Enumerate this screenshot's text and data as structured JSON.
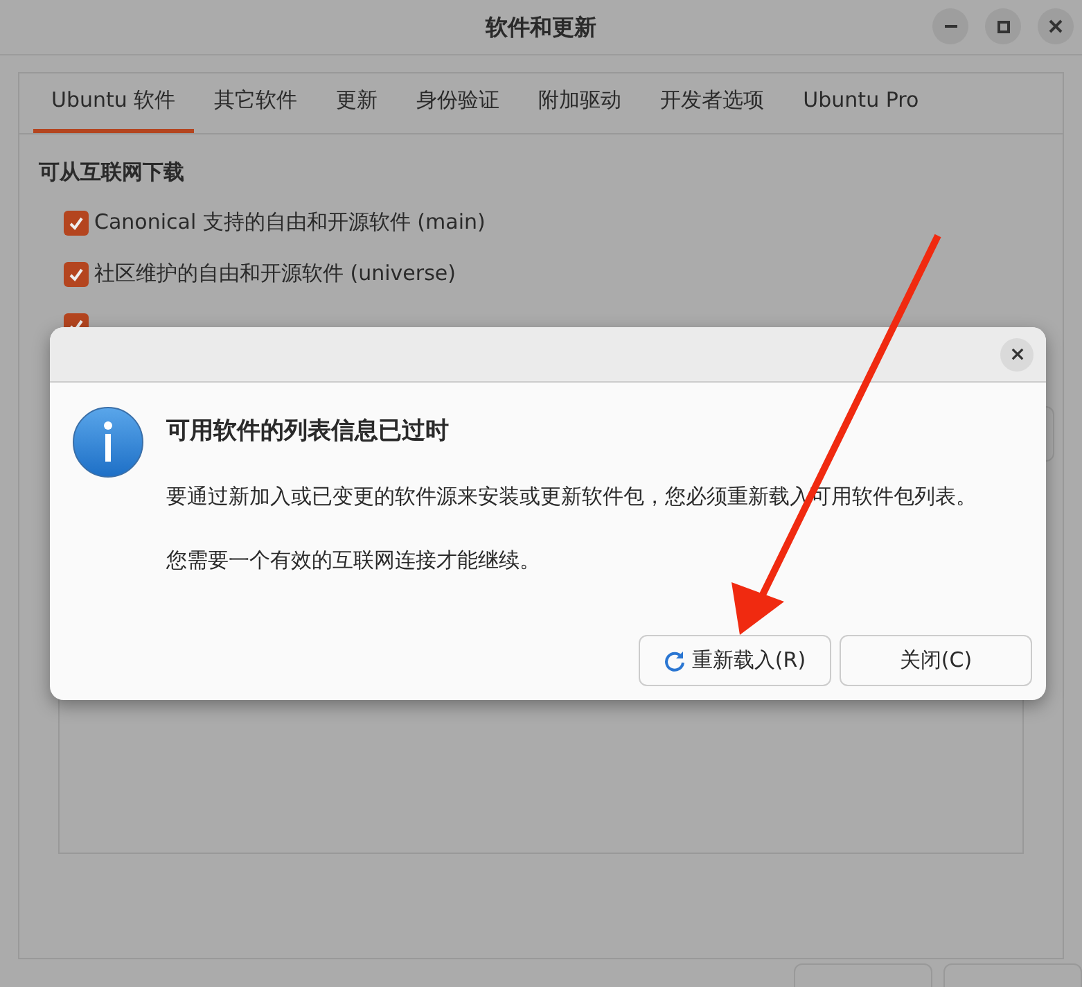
{
  "window": {
    "title": "软件和更新"
  },
  "tabs": [
    {
      "label": "Ubuntu 软件",
      "selected": true
    },
    {
      "label": "其它软件",
      "selected": false
    },
    {
      "label": "更新",
      "selected": false
    },
    {
      "label": "身份验证",
      "selected": false
    },
    {
      "label": "附加驱动",
      "selected": false
    },
    {
      "label": "开发者选项",
      "selected": false
    },
    {
      "label": "Ubuntu Pro",
      "selected": false
    }
  ],
  "section": {
    "heading": "可从互联网下载",
    "options": [
      {
        "label": "Canonical 支持的自由和开源软件 (main)",
        "checked": true
      },
      {
        "label": "社区维护的自由和开源软件 (universe)",
        "checked": true
      },
      {
        "checked": true
      }
    ]
  },
  "dialog": {
    "title": "可用软件的列表信息已过时",
    "message": [
      "要通过新加入或已变更的软件源来安装或更新软件包，您必须重新载入可用软件包列表。",
      "您需要一个有效的互联网连接才能继续。"
    ],
    "buttons": [
      {
        "label": "重新载入(R)",
        "kind": "reload"
      },
      {
        "label": "关闭(C)",
        "kind": "plain"
      }
    ]
  }
}
